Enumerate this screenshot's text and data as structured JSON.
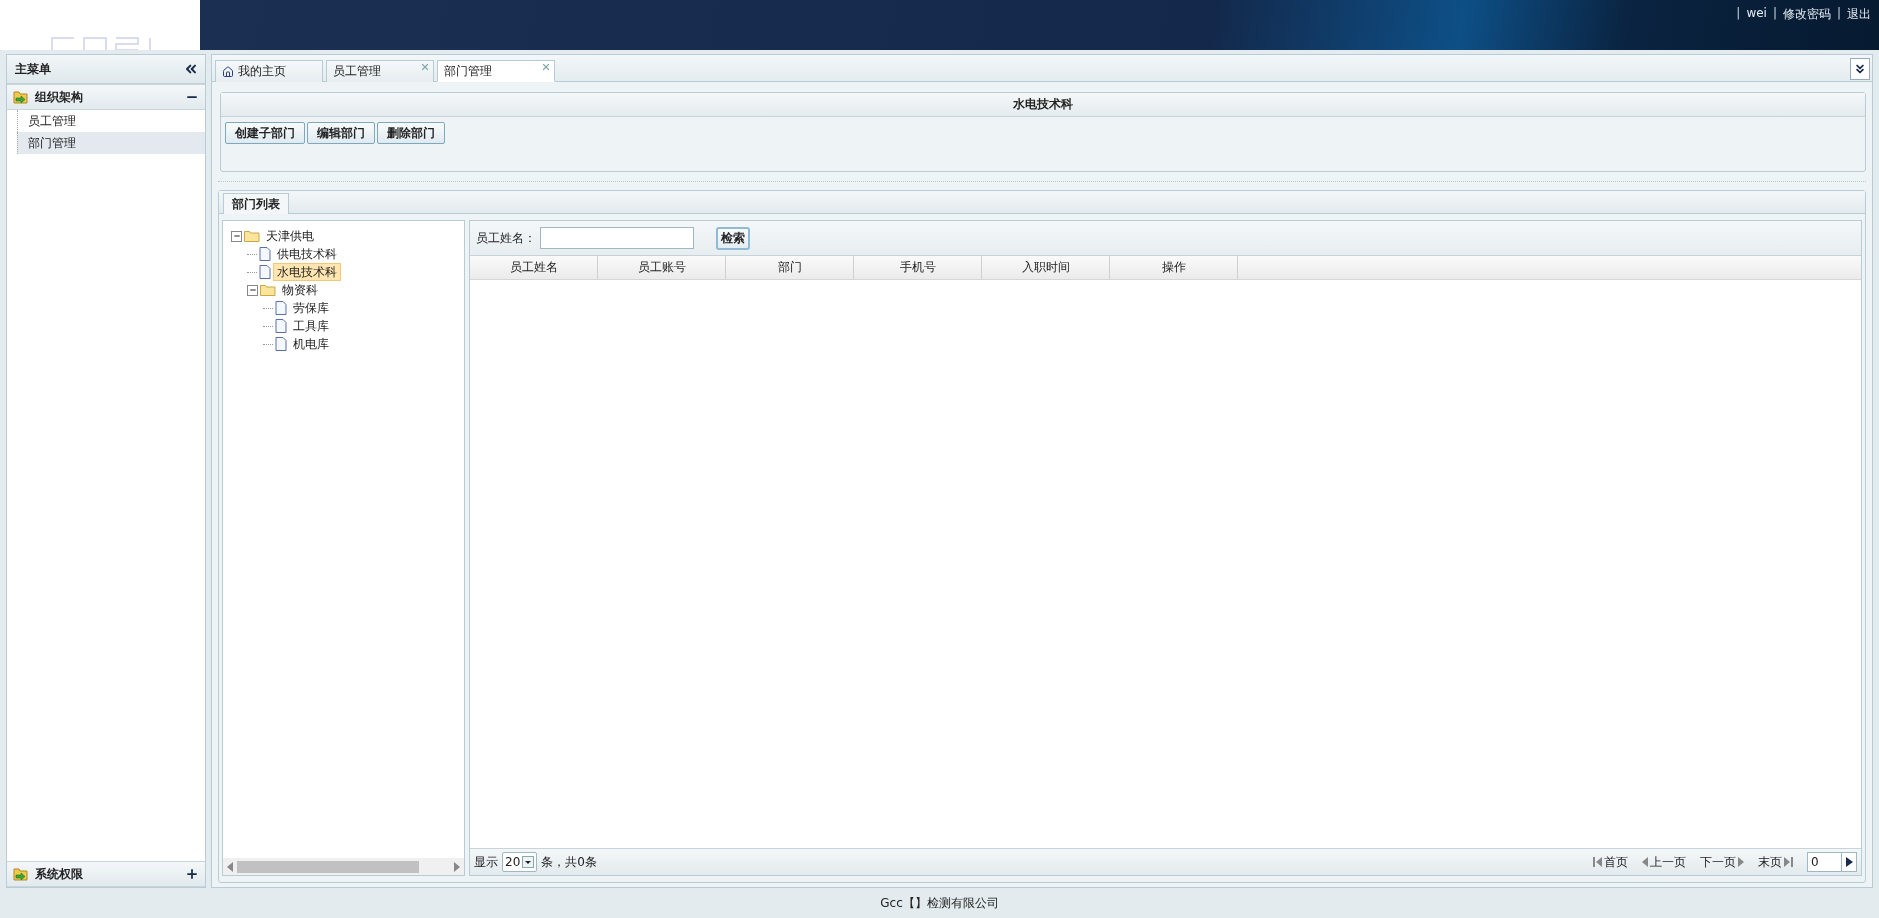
{
  "header": {
    "user_links": [
      {
        "separator": "|",
        "label": "wei"
      },
      {
        "separator": "|",
        "label": "修改密码"
      },
      {
        "separator": "|",
        "label": "退出"
      }
    ]
  },
  "sidebar": {
    "title": "主菜单",
    "sections": [
      {
        "title": "组织架构",
        "expanded": true,
        "items": [
          {
            "label": "员工管理",
            "selected": false
          },
          {
            "label": "部门管理",
            "selected": true
          }
        ]
      },
      {
        "title": "系统权限",
        "expanded": false
      }
    ]
  },
  "tabs": [
    {
      "label": "我的主页",
      "kind": "home",
      "closable": false,
      "selected": false
    },
    {
      "label": "员工管理",
      "kind": "page",
      "closable": true,
      "selected": false
    },
    {
      "label": "部门管理",
      "kind": "page",
      "closable": true,
      "selected": true
    }
  ],
  "dept_panel": {
    "title": "水电技术科",
    "buttons": [
      "创建子部门",
      "编辑部门",
      "删除部门"
    ]
  },
  "list_tab": {
    "label": "部门列表",
    "selected": true
  },
  "tree": [
    {
      "label": "天津供电",
      "expanded": true,
      "selected": false,
      "children": [
        {
          "label": "供电技术科",
          "selected": false
        },
        {
          "label": "水电技术科",
          "selected": true
        },
        {
          "label": "物资科",
          "expanded": true,
          "selected": false,
          "children": [
            {
              "label": "劳保库",
              "selected": false
            },
            {
              "label": "工具库",
              "selected": false
            },
            {
              "label": "机电库",
              "selected": false
            }
          ]
        }
      ]
    }
  ],
  "search": {
    "label": "员工姓名：",
    "button": "检索"
  },
  "table": {
    "columns": [
      "员工姓名",
      "员工账号",
      "部门",
      "手机号",
      "入职时间",
      "操作"
    ]
  },
  "pager": {
    "show_label": "显示",
    "page_size": "20",
    "summary": "条，共0条",
    "first": "首页",
    "prev": "上一页",
    "next": "下一页",
    "last": "末页",
    "page": "0"
  },
  "footer": "Gcc【】检测有限公司"
}
